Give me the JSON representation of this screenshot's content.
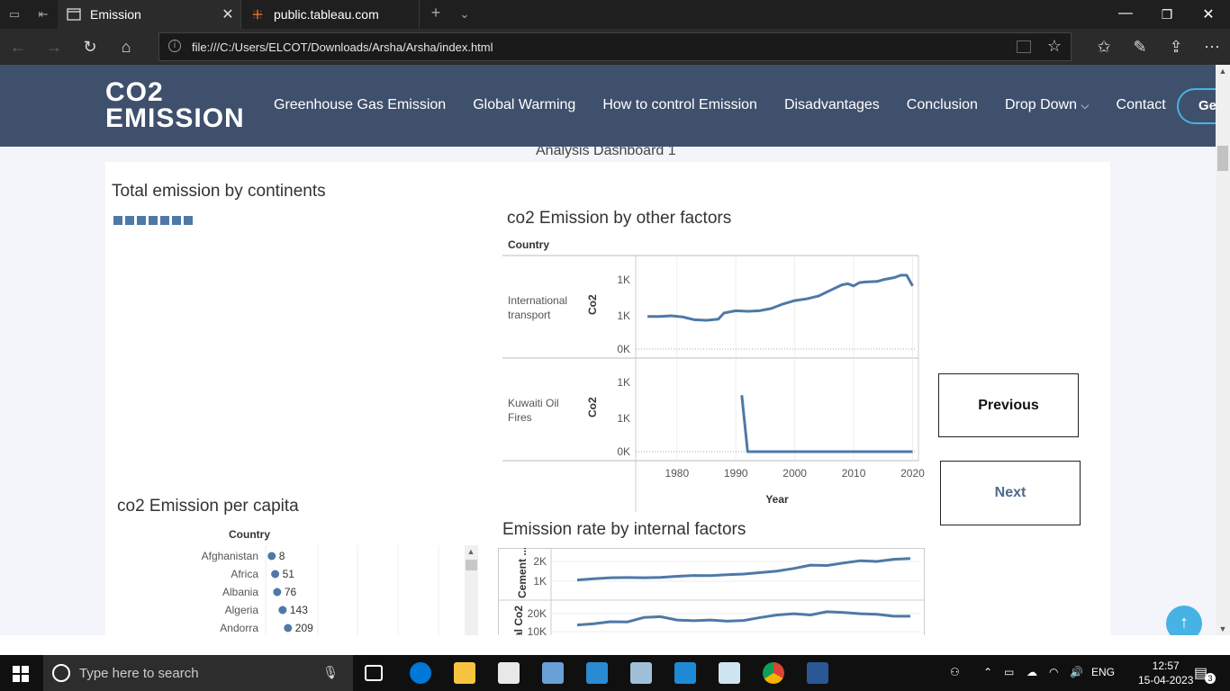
{
  "browser": {
    "tabs": [
      {
        "title": "Emission",
        "active": true
      },
      {
        "title": "public.tableau.com",
        "active": false
      }
    ],
    "url": "file:///C:/Users/ELCOT/Downloads/Arsha/Arsha/index.html"
  },
  "site": {
    "logo_line1": "CO2",
    "logo_line2": "EMISSION",
    "nav": [
      "Greenhouse Gas Emission",
      "Global Warming",
      "How to control Emission",
      "Disadvantages",
      "Conclusion",
      "Drop Down",
      "Contact"
    ],
    "cta": "Get"
  },
  "dashboard": {
    "title": "Analysis Dashboard 1",
    "panel_continents": "Total emission by continents",
    "panel_factors": "co2 Emission by other factors",
    "panel_percapita": "co2 Emission per capita",
    "panel_internal": "Emission rate by internal factors",
    "previous": "Previous",
    "next": "Next"
  },
  "chart_data": [
    {
      "type": "line",
      "title": "co2 Emission by other factors",
      "xlabel": "Year",
      "row_header": "Country",
      "ylabel": "Co2",
      "x_ticks": [
        "1980",
        "1990",
        "2000",
        "2010",
        "2020"
      ],
      "xlim": [
        1973,
        2021
      ],
      "series": [
        {
          "name": "International transport",
          "y_ticks": [
            "1K",
            "1K",
            "0K"
          ],
          "ylim": [
            0,
            1500
          ],
          "x": [
            1975,
            1977,
            1979,
            1981,
            1983,
            1985,
            1987,
            1988,
            1990,
            1992,
            1994,
            1996,
            1998,
            2000,
            2002,
            2004,
            2006,
            2008,
            2009,
            2010,
            2011,
            2012,
            2014,
            2015,
            2017,
            2018,
            2019,
            2020
          ],
          "y": [
            580,
            580,
            590,
            570,
            520,
            510,
            530,
            640,
            680,
            670,
            680,
            720,
            800,
            860,
            890,
            940,
            1040,
            1140,
            1160,
            1120,
            1180,
            1190,
            1200,
            1230,
            1270,
            1310,
            1310,
            1120
          ]
        },
        {
          "name": "Kuwaiti Oil Fires",
          "y_ticks": [
            "1K",
            "1K",
            "0K"
          ],
          "ylim": [
            0,
            1500
          ],
          "x": [
            1991,
            1992,
            2000,
            2010,
            2020
          ],
          "y": [
            1000,
            0,
            0,
            0,
            0
          ]
        }
      ]
    },
    {
      "type": "scatter",
      "title": "co2 Emission per capita",
      "row_header": "Country",
      "categories": [
        "Afghanistan",
        "Africa",
        "Albania",
        "Algeria",
        "Andorra"
      ],
      "values": [
        8,
        51,
        76,
        143,
        209
      ]
    },
    {
      "type": "line",
      "title": "Emission rate by internal factors",
      "series": [
        {
          "name": "Cement ...",
          "y_ticks": [
            "2K",
            "1K"
          ],
          "ylim": [
            0,
            2800
          ],
          "y": [
            1000,
            1080,
            1150,
            1160,
            1150,
            1170,
            1250,
            1300,
            1290,
            1350,
            1400,
            1500,
            1600,
            1780,
            2000,
            1980,
            2150,
            2300,
            2250,
            2400,
            2450
          ]
        },
        {
          "name": "al Co2",
          "y_ticks": [
            "20K",
            "10K"
          ],
          "ylim": [
            8000,
            26000
          ],
          "y": [
            17500,
            18000,
            18800,
            18700,
            20500,
            20800,
            19500,
            19200,
            19500,
            19000,
            19300,
            20500,
            21500,
            22000,
            21500,
            22800,
            22500,
            22000,
            21800,
            21000,
            21000
          ]
        }
      ]
    }
  ],
  "taskbar": {
    "search_placeholder": "Type here to search",
    "lang": "ENG",
    "time": "12:57",
    "date": "15-04-2023",
    "notifications": "3"
  }
}
